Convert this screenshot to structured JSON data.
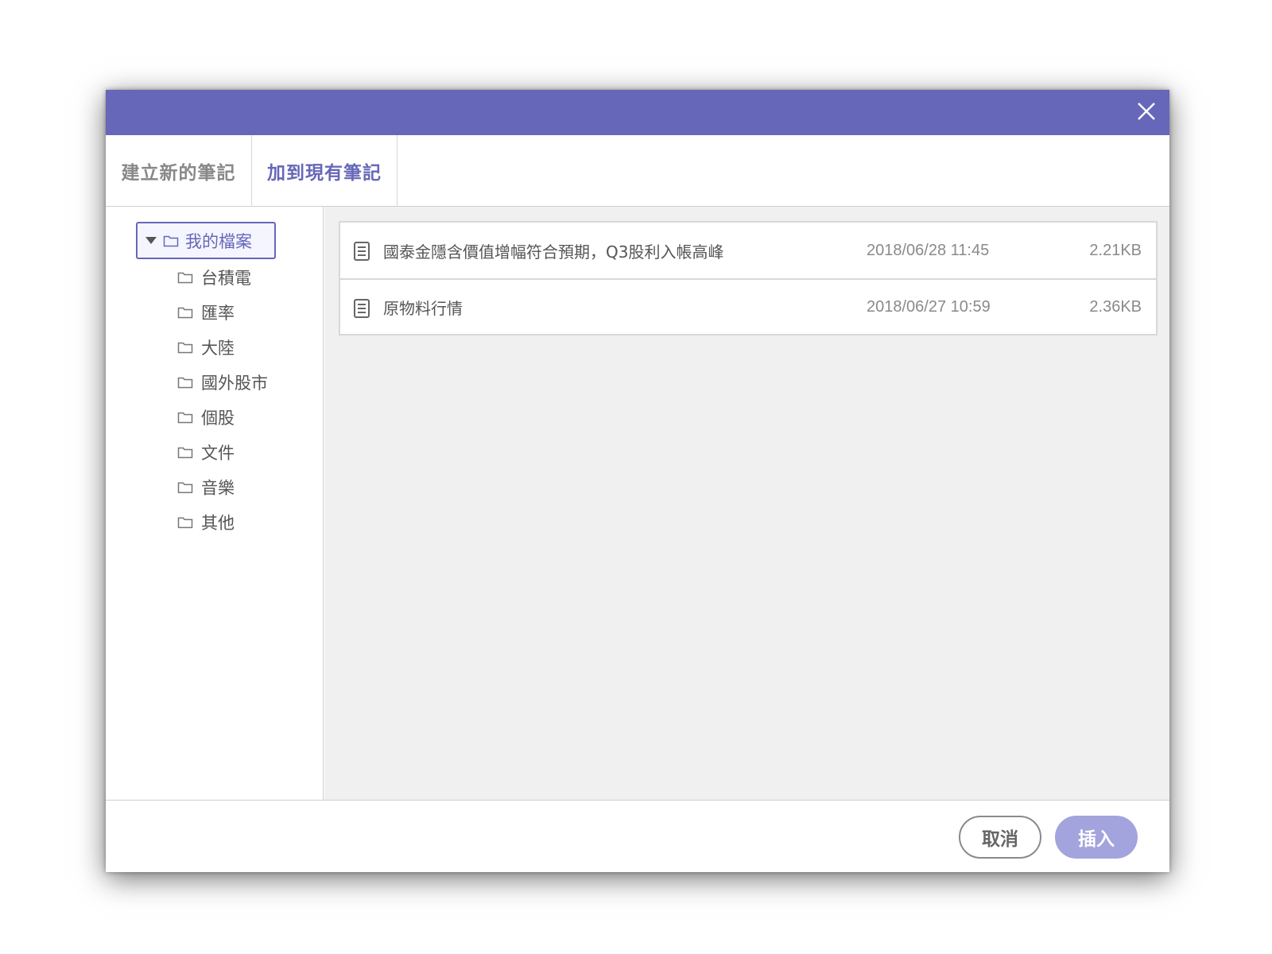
{
  "dialog": {
    "title_bar_color": "#6667b8",
    "close_icon": "close-icon"
  },
  "tabs": [
    {
      "label": "建立新的筆記",
      "active": false
    },
    {
      "label": "加到現有筆記",
      "active": true
    }
  ],
  "tree": {
    "root": {
      "label": "我的檔案",
      "expanded": true,
      "selected": true
    },
    "children": [
      {
        "label": "台積電"
      },
      {
        "label": "匯率"
      },
      {
        "label": "大陸"
      },
      {
        "label": "國外股市"
      },
      {
        "label": "個股"
      },
      {
        "label": "文件"
      },
      {
        "label": "音樂"
      },
      {
        "label": "其他"
      }
    ]
  },
  "files": [
    {
      "name": "國泰金隱含價值增幅符合預期，Q3股利入帳高峰",
      "date": "2018/06/28 11:45",
      "size": "2.21KB",
      "icon": "document-icon"
    },
    {
      "name": "原物料行情",
      "date": "2018/06/27 10:59",
      "size": "2.36KB",
      "icon": "document-icon"
    }
  ],
  "footer": {
    "cancel_label": "取消",
    "insert_label": "插入"
  }
}
